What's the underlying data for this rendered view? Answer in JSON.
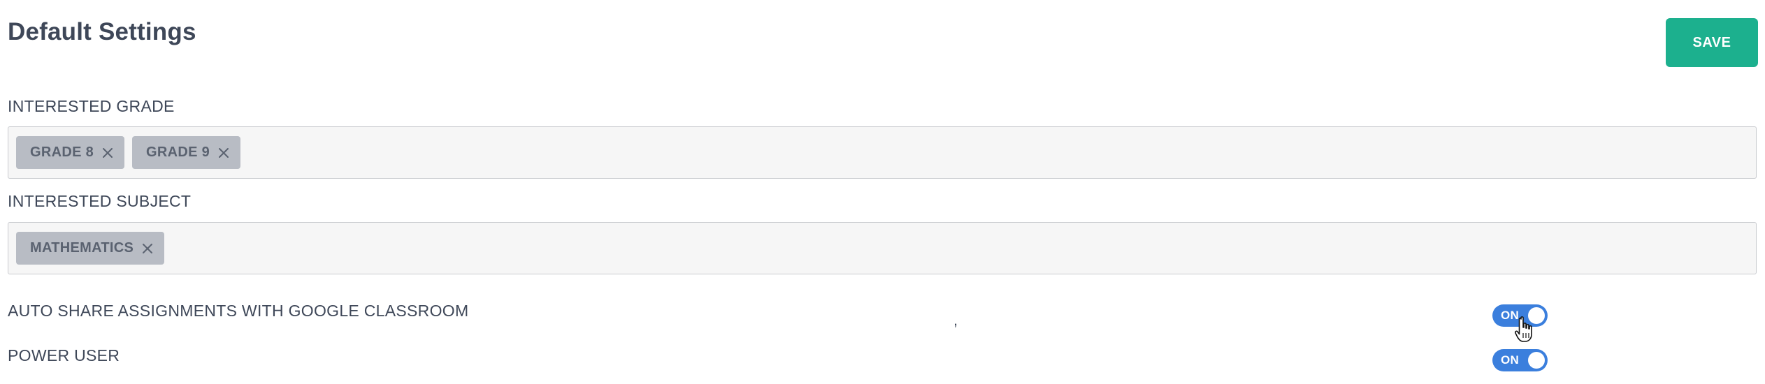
{
  "header": {
    "title": "Default Settings",
    "save_label": "SAVE"
  },
  "interested_grade": {
    "label": "INTERESTED GRADE",
    "tags": [
      "GRADE 8",
      "GRADE 9"
    ]
  },
  "interested_subject": {
    "label": "INTERESTED SUBJECT",
    "tags": [
      "MATHEMATICS"
    ]
  },
  "auto_share": {
    "label": "AUTO SHARE ASSIGNMENTS WITH GOOGLE CLASSROOM",
    "toggle_text": "ON"
  },
  "power_user": {
    "label": "POWER USER",
    "toggle_text": "ON"
  },
  "stray_mark": ",",
  "colors": {
    "accent": "#1cb08e",
    "toggle_on": "#3b7fdd",
    "tag_bg": "#b8bcc4",
    "text": "#3e4758"
  },
  "icons": {
    "tag_remove": "close-icon",
    "cursor": "hand-pointer-cursor-icon"
  }
}
